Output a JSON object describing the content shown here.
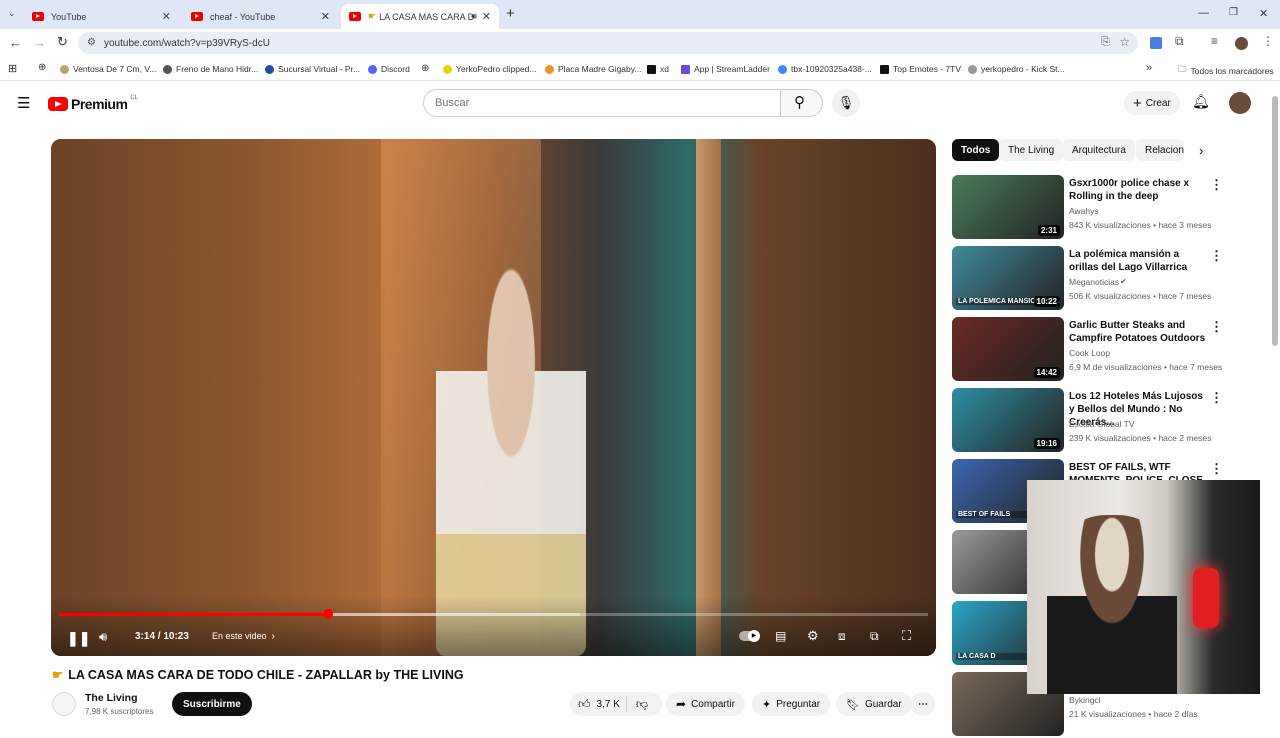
{
  "browser": {
    "tabs": [
      {
        "title": "YouTube"
      },
      {
        "title": "cheaf - YouTube"
      },
      {
        "title": "LA CASA MAS CARA D"
      }
    ],
    "url": "youtube.com/watch?v=p39VRyS-dcU",
    "bookmarks": [
      "Ventosa De 7 Cm, V...",
      "Freno de Mano Hidr...",
      "Sucursal Virtual - Pr...",
      "Discord",
      "YerkoPedro clipped...",
      "Placa Madre Gigaby...",
      "xd",
      "App | StreamLadder",
      "tbx-10920325a438-...",
      "Top Emotes - 7TV",
      "yerkopedro - Kick St..."
    ],
    "all_bookmarks": "Todos los marcadores"
  },
  "yt": {
    "logo": "Premium",
    "country": "CL",
    "search_placeholder": "Buscar",
    "create_label": "Crear"
  },
  "video": {
    "time": "3:14 / 10:23",
    "chapter": "En este video",
    "progress": 0.31,
    "title": "LA CASA MAS CARA DE TODO CHILE - ZAPALLAR by THE LIVING",
    "channel": "The Living",
    "subs": "7,98 K suscriptores",
    "subscribe": "Suscribirme",
    "likes": "3,7 K",
    "share": "Compartir",
    "ask": "Preguntar",
    "save": "Guardar"
  },
  "chips": [
    "Todos",
    "The Living",
    "Arquitectura",
    "Relaciona"
  ],
  "recs": [
    {
      "title": "Gsxr1000r police chase x Rolling in the deep",
      "channel": "Awahys",
      "meta": "843 K visualizaciones • hace 3 meses",
      "dur": "2:31",
      "color": "#4a7d5a"
    },
    {
      "title": "La polémica mansión a orillas del Lago Villarrica",
      "channel": "Meganoticias",
      "meta": "506 K visualizaciones • hace 7 meses",
      "dur": "10:22",
      "color": "#3f8a9e",
      "overlay": "LA POLÉMICA MANSIÓN EN LAGO VILLARRI"
    },
    {
      "title": "Garlic Butter Steaks and Campfire Potatoes Outdoors",
      "channel": "Cook Loop",
      "meta": "6,9 M de visualizaciones • hace 7 meses",
      "dur": "14:42",
      "color": "#6b2a22"
    },
    {
      "title": "Los 12 Hoteles Más Lujosos y Bellos del Mundo : No Creerás...",
      "channel": "Escala Global TV",
      "meta": "239 K visualizaciones • hace 2 meses",
      "dur": "19:16",
      "color": "#2f8fa6"
    },
    {
      "title": "BEST OF FAILS, WTF MOMENTS, POLICE, CLOSE",
      "channel": "",
      "meta": "",
      "dur": "",
      "color": "#3a67b0",
      "overlay": "BEST OF FAILS"
    },
    {
      "title": "",
      "channel": "",
      "meta": "",
      "dur": "",
      "color": "#9a9a9a"
    },
    {
      "title": "",
      "channel": "",
      "meta": "",
      "dur": "",
      "color": "#2aa6c8",
      "overlay": "LA CASA D"
    },
    {
      "title": "",
      "channel": "Bykingcl",
      "meta": "21 K visualizaciones • hace 2 días",
      "dur": "",
      "color": "#7a6a5a"
    }
  ]
}
